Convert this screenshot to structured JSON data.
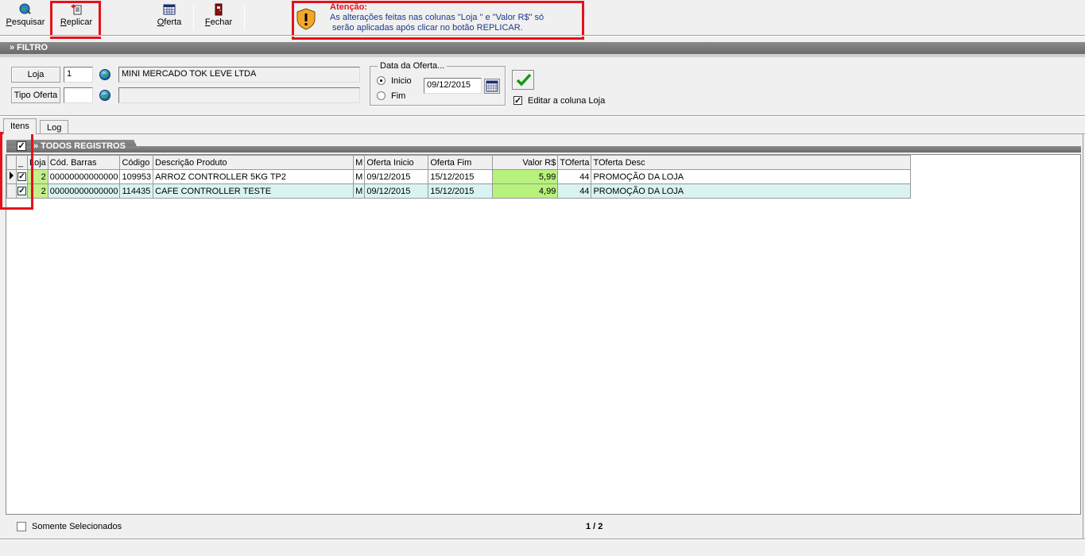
{
  "toolbar": {
    "pesquisar": "Pesquisar",
    "replicar": "Replicar",
    "oferta": "Oferta",
    "fechar": "Fechar"
  },
  "warning": {
    "title": "Atenção:",
    "line1": "As alterações feitas nas colunas \"Loja \" e \"Valor R$\" só",
    "line2": " serão aplicadas após clicar no botão REPLICAR."
  },
  "filtro": {
    "header": "» FILTRO",
    "loja_label": "Loja",
    "loja_value": "1",
    "loja_desc": "MINI MERCADO TOK LEVE LTDA",
    "tipo_label": "Tipo Oferta",
    "tipo_value": "",
    "tipo_desc": ""
  },
  "data_oferta": {
    "legend": "Data da Oferta...",
    "inicio": "Inicio",
    "fim": "Fim",
    "date": "09/12/2015",
    "selected": "Inicio"
  },
  "editar_loja": {
    "label": "Editar a coluna Loja",
    "checked": true
  },
  "tabs": [
    {
      "label": "Itens",
      "active": true
    },
    {
      "label": "Log",
      "active": false
    }
  ],
  "todos": {
    "label": "» TODOS REGISTROS",
    "checked": true
  },
  "grid": {
    "columns": [
      "_",
      "Loja",
      "Cód. Barras",
      "Código",
      "Descrição Produto",
      "M",
      "Oferta Inicio",
      "Oferta Fim",
      "Valor R$",
      "TOferta",
      "TOferta Desc"
    ],
    "rows": [
      {
        "checked": true,
        "loja": "2",
        "barras": "00000000000000",
        "codigo": "109953",
        "descricao": "ARROZ CONTROLLER 5KG TP2",
        "m": "M",
        "inicio": "09/12/2015",
        "fim": "15/12/2015",
        "valor": "5,99",
        "toferta": "44",
        "desc": "PROMOÇÃO DA LOJA"
      },
      {
        "checked": true,
        "loja": "2",
        "barras": "00000000000000",
        "codigo": "114435",
        "descricao": "CAFE CONTROLLER TESTE",
        "m": "M",
        "inicio": "09/12/2015",
        "fim": "15/12/2015",
        "valor": "4,99",
        "toferta": "44",
        "desc": "PROMOÇÃO DA LOJA"
      }
    ]
  },
  "footer": {
    "somente": "Somente Selecionados",
    "pager": "1 / 2"
  },
  "colors": {
    "accent_red": "#e3131b",
    "green_cell": "#b7f27d",
    "row_alt": "#d9f3f3"
  }
}
